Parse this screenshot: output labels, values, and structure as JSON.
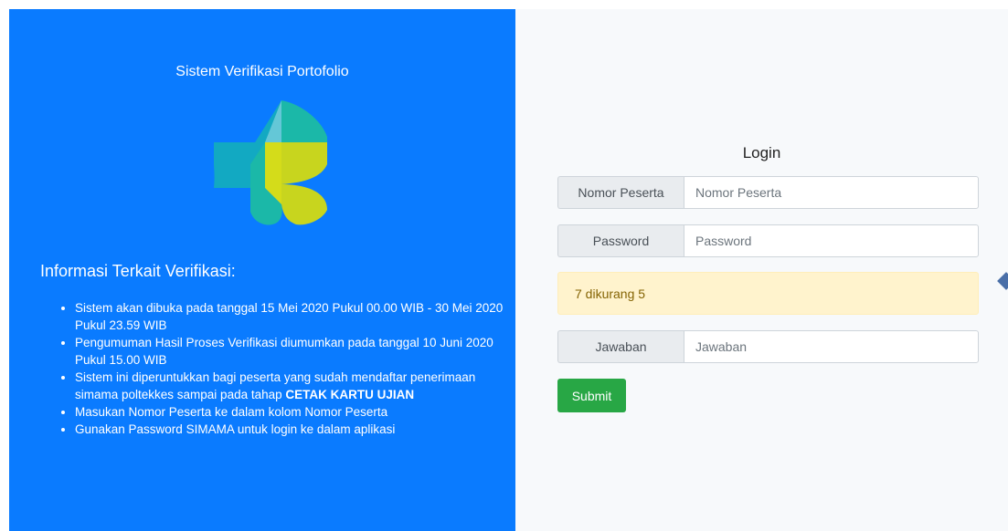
{
  "left_panel": {
    "app_title": "Sistem Verifikasi Portofolio",
    "logo_icon": "kemenkes-logo-icon",
    "info_heading": "Informasi Terkait Verifikasi:",
    "info_items": [
      "Sistem akan dibuka pada tanggal 15 Mei 2020 Pukul 00.00 WIB - 30 Mei 2020 Pukul 23.59 WIB",
      "Pengumuman Hasil Proses Verifikasi diumumkan pada tanggal 10 Juni 2020 Pukul 15.00 WIB",
      {
        "text": "Sistem ini diperuntukkan bagi peserta yang sudah mendaftar penerimaan simama poltekkes sampai pada tahap ",
        "bold": "CETAK KARTU UJIAN"
      },
      "Masukan Nomor Peserta ke dalam kolom Nomor Peserta",
      "Gunakan Password SIMAMA untuk login ke dalam aplikasi"
    ],
    "colors": {
      "background": "#0a7bff"
    }
  },
  "login": {
    "title": "Login",
    "nomor_label": "Nomor Peserta",
    "nomor_placeholder": "Nomor Peserta",
    "nomor_value": "",
    "password_label": "Password",
    "password_placeholder": "Password",
    "password_value": "",
    "captcha_text": "7 dikurang 5",
    "jawaban_label": "Jawaban",
    "jawaban_placeholder": "Jawaban",
    "jawaban_value": "",
    "submit_label": "Submit",
    "colors": {
      "submit": "#28a745",
      "captcha_bg": "#fff3cd"
    }
  }
}
